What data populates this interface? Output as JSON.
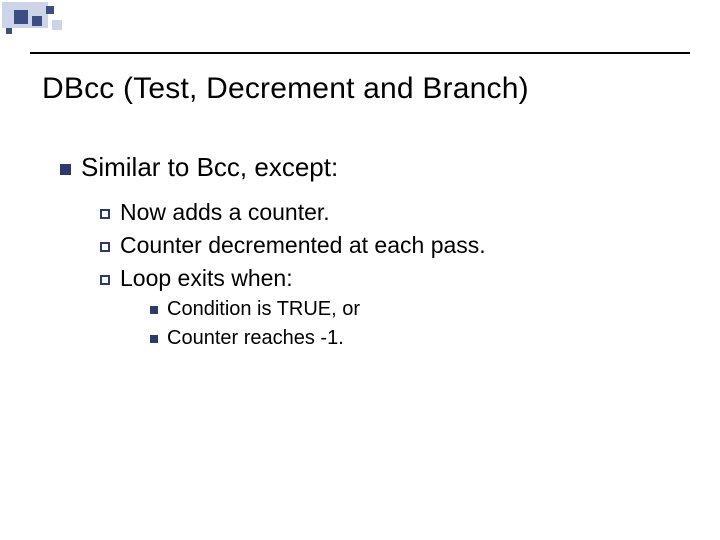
{
  "title": "DBcc (Test, Decrement and Branch)",
  "body": {
    "lvl1": "Similar to Bcc, except:",
    "lvl2": [
      "Now adds a counter.",
      "Counter decremented at each pass.",
      "Loop exits when:"
    ],
    "lvl3": [
      "Condition is TRUE, or",
      "Counter reaches -1."
    ]
  }
}
